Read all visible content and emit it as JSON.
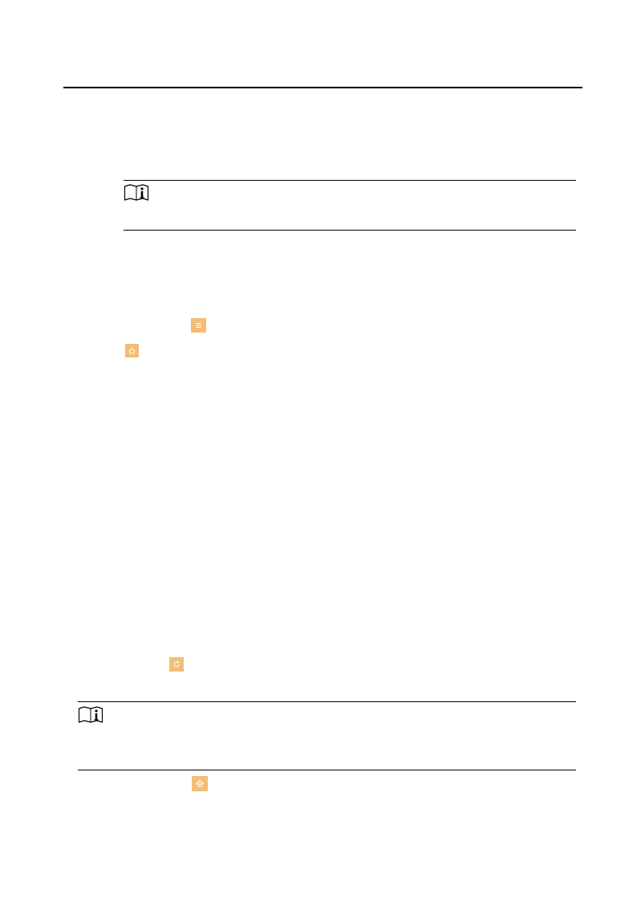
{
  "colors": {
    "accent": "#f2b25e",
    "glyph": "#ffffff",
    "rule": "#000000"
  },
  "notes": [
    {
      "icon": "note-info-icon"
    },
    {
      "icon": "note-info-icon"
    }
  ],
  "inline_icons": [
    {
      "icon": "list-menu-icon"
    },
    {
      "icon": "home-icon"
    },
    {
      "icon": "refresh-icon"
    },
    {
      "icon": "settings-icon"
    }
  ]
}
